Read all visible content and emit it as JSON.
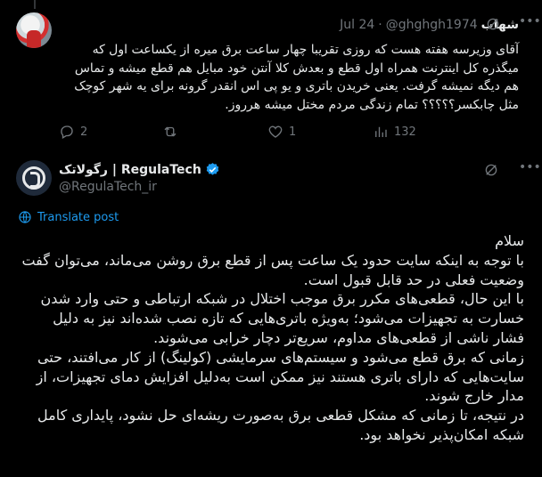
{
  "reply": {
    "display_name": "شهاب",
    "handle": "@ghghgh1974",
    "separator": "·",
    "date": "Jul 24",
    "body": "آقای وزیرسه هفته هست که روزی تقریبا چهار ساعت برق میره از یکساعت اول که\nمیگذره کل اینترنت همراه اول قطع و بعدش کلا آنتن خود مبایل هم قطع میشه و تماس\nهم دیگه نمیشه گرفت. یعنی خریدن باتری و یو پی اس انقدر گرونه برای یه شهر کوچک\nمثل چابکسر؟؟؟؟؟ تمام زندگی مردم مختل میشه هرروز.",
    "stats": {
      "replies": "2",
      "reposts": "",
      "likes": "1",
      "views": "132"
    }
  },
  "tweet": {
    "display_name": "رگولاتک | RegulaTech",
    "handle": "@RegulaTech_ir",
    "translate_label": "Translate post",
    "body": "سلام\nبا توجه به اینکه سایت حدود یک ساعت پس از قطع برق روشن می‌ماند، می‌توان گفت\nوضعیت فعلی در حد قابل قبول است.\nبا این حال، قطعی‌های مکرر برق موجب اختلال در شبکه ارتباطی و حتی وارد شدن\nخسارت به تجهیزات می‌شود؛ به‌ویژه باتری‌هایی که تازه نصب شده‌اند نیز به دلیل\nفشار ناشی از قطعی‌های مداوم، سریع‌تر دچار خرابی می‌شوند.\nزمانی که برق قطع می‌شود و سیستم‌های سرمایشی (کولینگ) از کار می‌افتند، حتی\nسایت‌هایی که دارای باتری هستند نیز ممکن است به‌دلیل افزایش دمای تجهیزات، از\nمدار خارج شوند.\nدر نتیجه، تا زمانی که مشکل قطعی برق به‌صورت ریشه‌ای حل نشود، پایداری کامل\nشبکه امکان‌پذیر نخواهد بود."
  },
  "icons": {
    "more": "more-icon",
    "grok": "grok-icon",
    "reply": "reply-icon",
    "repost": "repost-icon",
    "like": "like-icon",
    "views": "views-icon",
    "verified": "verified-badge-icon",
    "translate": "globe-icon"
  },
  "colors": {
    "background": "#000000",
    "text": "#e7e9ea",
    "muted": "#71767b",
    "accent": "#1d9bf0"
  }
}
